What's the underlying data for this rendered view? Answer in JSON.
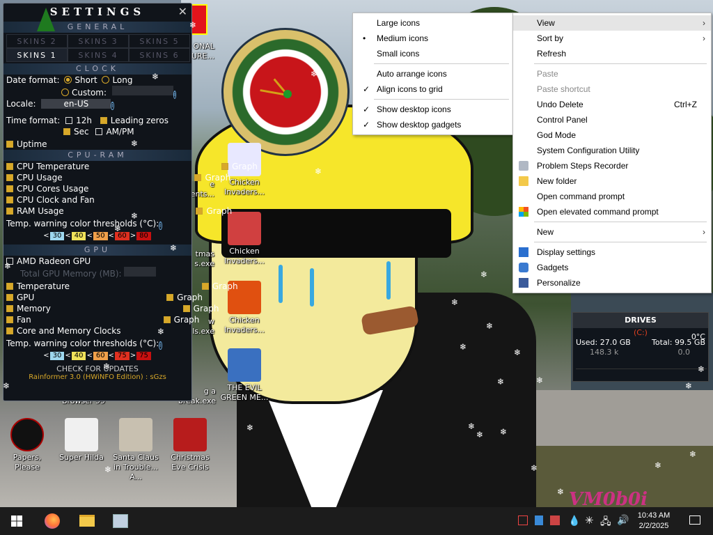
{
  "settings": {
    "title": "SETTINGS",
    "general": "GENERAL",
    "skins": [
      "SKINS 2",
      "SKINS 3",
      "SKINS 5",
      "SKINS 1",
      "SKINS 4",
      "SKINS 6"
    ],
    "clock_hdr": "CLOCK",
    "date_format": "Date format:",
    "short": "Short",
    "long": "Long",
    "custom": "Custom:",
    "locale": "Locale:",
    "locale_value": "en-US",
    "time_format": "Time format:",
    "h12": "12h",
    "leading_zeros": "Leading zeros",
    "sec": "Sec",
    "ampm": "AM/PM",
    "uptime": "Uptime",
    "cpuram_hdr": "CPU-RAM",
    "cpu_temp": "CPU Temperature",
    "cpu_usage": "CPU Usage",
    "cpu_cores": "CPU Cores Usage",
    "cpu_clock": "CPU Clock and Fan",
    "ram_usage": "RAM Usage",
    "graph": "Graph",
    "thresholds": "Temp. warning color thresholds (°C):",
    "thr1": [
      "30",
      "40",
      "50",
      "60",
      "80"
    ],
    "gpu_hdr": "GPU",
    "amd": "AMD Radeon GPU",
    "total_mem": "Total GPU Memory (MB):",
    "temperature": "Temperature",
    "gpu": "GPU",
    "memory": "Memory",
    "fan": "Fan",
    "core_mem": "Core and Memory Clocks",
    "thr2": [
      "30",
      "40",
      "60",
      "75",
      "75"
    ],
    "check_updates": "CHECK FOR UPDATES",
    "edition": "Rainformer 3.0 (HWiNFO Edition) : sGzs"
  },
  "icons": [
    {
      "label": "Chicken Invaders...",
      "color": "#e8e8ff"
    },
    {
      "label": "Chicken Invaders...",
      "color": "#d04040"
    },
    {
      "label": "Chicken Invaders...",
      "color": "#e05010"
    },
    {
      "label": "THE EVIL GREEN ME...",
      "color": "#3a70c0"
    },
    {
      "label": "Papers, Please",
      "color": "#111"
    },
    {
      "label": "Super Hilda",
      "color": "#f0f0f0"
    },
    {
      "label": "Santa Claus in Trouble... A...",
      "color": "#c8c0b0"
    },
    {
      "label": "Christmas Eve Crisis",
      "color": "#b71c1c"
    }
  ],
  "partial_labels": [
    "e",
    "ents...",
    "tmas",
    "s.exe",
    "w",
    "ls.exe",
    "g a",
    "break.exe",
    "Browser 99",
    "ONAL",
    "URE..."
  ],
  "drives": {
    "title": "DRIVES",
    "letter": "(C:)",
    "temp": "0°C",
    "used": "Used: 27.0 GB",
    "total": "Total: 99.5 GB",
    "read": "148.3 k",
    "write": "0.0"
  },
  "view_menu": [
    {
      "label": "Large icons",
      "mark": ""
    },
    {
      "label": "Medium icons",
      "mark": "•"
    },
    {
      "label": "Small icons",
      "mark": ""
    },
    {
      "label": "Auto arrange icons",
      "mark": ""
    },
    {
      "label": "Align icons to grid",
      "mark": "✓"
    },
    {
      "label": "Show desktop icons",
      "mark": "✓"
    },
    {
      "label": "Show desktop gadgets",
      "mark": "✓"
    }
  ],
  "context_menu": {
    "view": "View",
    "sort_by": "Sort by",
    "refresh": "Refresh",
    "paste": "Paste",
    "paste_shortcut": "Paste shortcut",
    "undo_delete": "Undo Delete",
    "undo_shortcut": "Ctrl+Z",
    "control_panel": "Control Panel",
    "god_mode": "God Mode",
    "sys_config": "System Configuration Utility",
    "psr": "Problem Steps Recorder",
    "new_folder": "New folder",
    "cmd": "Open command prompt",
    "cmd_elev": "Open elevated command prompt",
    "new": "New",
    "display": "Display settings",
    "gadgets": "Gadgets",
    "personalize": "Personalize"
  },
  "taskbar": {
    "time": "10:43 AM",
    "date": "2/2/2025"
  },
  "watermark": "VM0b0i",
  "colors": {
    "accent": "#d8a829",
    "cpu_temp": "#c81e1e",
    "cpu_usage": "#c8d4e4",
    "ram": "#6cc02a",
    "gpu_temp": "#c81e1e",
    "gpu": "#c8d4e4",
    "mem": "#6cc02a",
    "fan": "#2aa8e0"
  }
}
